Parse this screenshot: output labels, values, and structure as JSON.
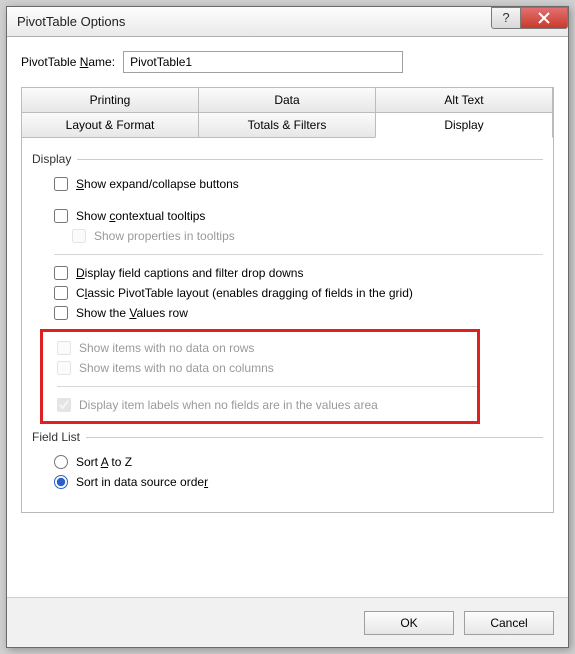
{
  "title": "PivotTable Options",
  "name_label_pre": "PivotTable ",
  "name_label_u": "N",
  "name_label_post": "ame:",
  "name_value": "PivotTable1",
  "tabs_row1": [
    "Printing",
    "Data",
    "Alt Text"
  ],
  "tabs_row2": [
    "Layout & Format",
    "Totals & Filters",
    "Display"
  ],
  "group_display": "Display",
  "opt1_u": "S",
  "opt1_post": "how expand/collapse buttons",
  "opt2_pre": "Show ",
  "opt2_u": "c",
  "opt2_post": "ontextual tooltips",
  "opt3": "Show properties in tooltips",
  "opt4_u": "D",
  "opt4_post": "isplay field captions and filter drop downs",
  "opt5_pre": "C",
  "opt5_u": "l",
  "opt5_post": "assic PivotTable layout (enables dragging of fields in the grid)",
  "opt6_pre": "Show the ",
  "opt6_u": "V",
  "opt6_post": "alues row",
  "opt7": "Show items with no data on rows",
  "opt8": "Show items with no data on columns",
  "opt9": "Display item labels when no fields are in the values area",
  "group_fieldlist": "Field List",
  "radio1_pre": "Sort ",
  "radio1_u": "A",
  "radio1_post": " to Z",
  "radio2_pre": "Sort in data source orde",
  "radio2_u": "r",
  "ok": "OK",
  "cancel": "Cancel"
}
